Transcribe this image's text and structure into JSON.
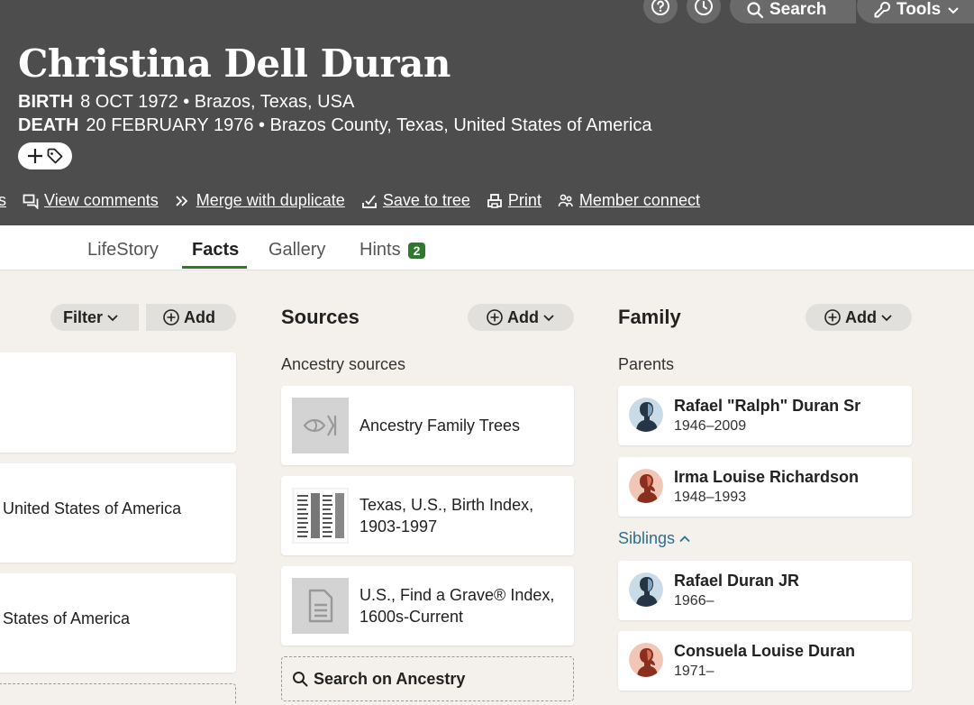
{
  "header": {
    "top_buttons": {
      "search_label": "Search",
      "tools_label": "Tools"
    },
    "person_name": "Christina Dell Duran",
    "birth": {
      "label": "BIRTH",
      "value": "8 OCT 1972 • Brazos, Texas, USA"
    },
    "death": {
      "label": "DEATH",
      "value": "20 FEBRUARY 1976 • Brazos County, Texas, United States of America"
    },
    "actions": [
      {
        "label": "es",
        "icon": "partial"
      },
      {
        "label": "View comments",
        "icon": "comments-icon"
      },
      {
        "label": "Merge with duplicate",
        "icon": "merge-icon"
      },
      {
        "label": "Save to tree",
        "icon": "save-icon"
      },
      {
        "label": "Print",
        "icon": "print-icon"
      },
      {
        "label": "Member connect",
        "icon": "member-connect-icon"
      }
    ]
  },
  "tabs": [
    {
      "label": "LifeStory",
      "active": false
    },
    {
      "label": "Facts",
      "active": true
    },
    {
      "label": "Gallery",
      "active": false
    },
    {
      "label": "Hints",
      "active": false,
      "badge": "2"
    }
  ],
  "facts": {
    "filter_label": "Filter",
    "add_label": "Add",
    "partial_rows": [
      "United States of America",
      "States of America"
    ]
  },
  "sources": {
    "title": "Sources",
    "add_label": "Add",
    "subheading": "Ancestry sources",
    "items": [
      {
        "line1": "Ancestry Family Trees",
        "line2": "",
        "thumb": "leaf-icon"
      },
      {
        "line1": "Texas, U.S., Birth Index,",
        "line2": "1903-1997",
        "thumb": "document-scan"
      },
      {
        "line1": "U.S., Find a Grave® Index,",
        "line2": "1600s-Current",
        "thumb": "document-icon"
      }
    ],
    "search_label": "Search on Ancestry"
  },
  "family": {
    "title": "Family",
    "add_label": "Add",
    "parents_label": "Parents",
    "parents": [
      {
        "name": "Rafael \"Ralph\" Duran Sr",
        "dates": "1946–2009",
        "gender": "male"
      },
      {
        "name": "Irma Louise Richardson",
        "dates": "1948–1993",
        "gender": "female"
      }
    ],
    "siblings_label": "Siblings",
    "siblings": [
      {
        "name": "Rafael Duran JR",
        "dates": "1966–",
        "gender": "male"
      },
      {
        "name": "Consuela Louise Duran",
        "dates": "1971–",
        "gender": "female"
      }
    ]
  },
  "colors": {
    "header_bg": "#4d4d4d",
    "accent_green": "#2d7a2d",
    "link_blue": "#2e6f8e",
    "page_bg": "#f4f1ec"
  }
}
